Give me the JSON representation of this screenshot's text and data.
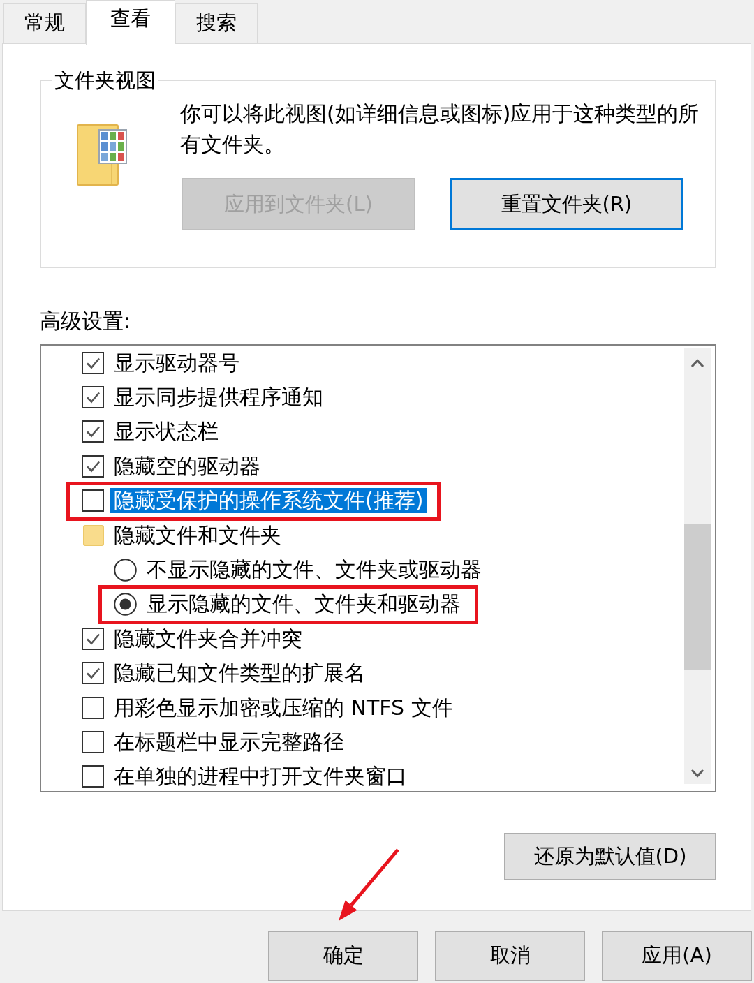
{
  "tabs": [
    {
      "label": "常规",
      "selected": false
    },
    {
      "label": "查看",
      "selected": true
    },
    {
      "label": "搜索",
      "selected": false
    }
  ],
  "folder_views": {
    "title": "文件夹视图",
    "description": "你可以将此视图(如详细信息或图标)应用于这种类型的所有文件夹。",
    "buttons": [
      {
        "label": "应用到文件夹(L)",
        "disabled": true,
        "focused": false
      },
      {
        "label": "重置文件夹(R)",
        "disabled": false,
        "focused": true
      }
    ]
  },
  "advanced_settings": {
    "label": "高级设置:",
    "items": [
      {
        "kind": "checkbox",
        "label": "显示驱动器号",
        "checked": true,
        "selected": false,
        "marked": false
      },
      {
        "kind": "checkbox",
        "label": "显示同步提供程序通知",
        "checked": true,
        "selected": false,
        "marked": false
      },
      {
        "kind": "checkbox",
        "label": "显示状态栏",
        "checked": true,
        "selected": false,
        "marked": false
      },
      {
        "kind": "checkbox",
        "label": "隐藏空的驱动器",
        "checked": true,
        "selected": false,
        "marked": false
      },
      {
        "kind": "checkbox",
        "label": "隐藏受保护的操作系统文件(推荐)",
        "checked": false,
        "selected": true,
        "marked": true
      },
      {
        "kind": "folder",
        "label": "隐藏文件和文件夹",
        "selected": false,
        "marked": false,
        "children": [
          {
            "kind": "radio",
            "label": "不显示隐藏的文件、文件夹或驱动器",
            "checked": false,
            "selected": false,
            "marked": false
          },
          {
            "kind": "radio",
            "label": "显示隐藏的文件、文件夹和驱动器",
            "checked": true,
            "selected": false,
            "marked": true
          }
        ]
      },
      {
        "kind": "checkbox",
        "label": "隐藏文件夹合并冲突",
        "checked": true,
        "selected": false,
        "marked": false
      },
      {
        "kind": "checkbox",
        "label": "隐藏已知文件类型的扩展名",
        "checked": true,
        "selected": false,
        "marked": false
      },
      {
        "kind": "checkbox",
        "label": "用彩色显示加密或压缩的 NTFS 文件",
        "checked": false,
        "selected": false,
        "marked": false
      },
      {
        "kind": "checkbox",
        "label": "在标题栏中显示完整路径",
        "checked": false,
        "selected": false,
        "marked": false
      },
      {
        "kind": "checkbox",
        "label": "在单独的进程中打开文件夹窗口",
        "checked": false,
        "selected": false,
        "marked": false
      }
    ]
  },
  "restore_button": {
    "label": "还原为默认值(D)"
  },
  "dialog_buttons": [
    {
      "label": "确定",
      "marked": true
    },
    {
      "label": "取消",
      "marked": false
    },
    {
      "label": "应用(A)",
      "marked": false
    }
  ]
}
